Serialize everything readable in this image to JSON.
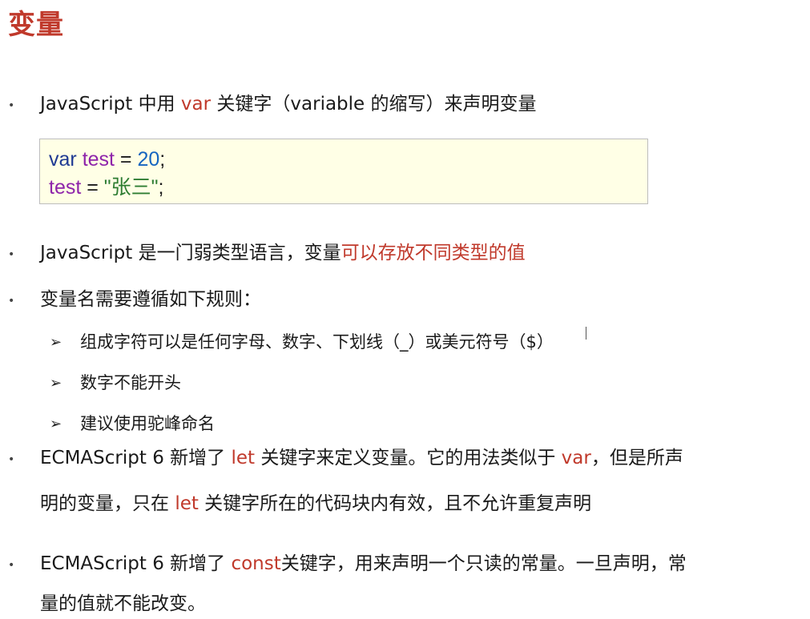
{
  "slide": {
    "title": "变量"
  },
  "bullets": [
    {
      "parts": [
        "JavaScript 中用 ",
        "var",
        " 关键字（variable 的缩写）来声明变量"
      ]
    },
    {
      "parts": [
        "JavaScript 是一门弱类型语言，变量",
        "可以存放不同类型的值"
      ]
    },
    {
      "text": "变量名需要遵循如下规则："
    },
    {
      "line1_parts": [
        "ECMAScript 6 新增了 ",
        "let",
        " 关键字来定义变量。它的用法类似于 ",
        "var",
        "，但是所声"
      ],
      "line2_parts": [
        "明的变量，只在 ",
        "let",
        " 关键字所在的代码块内有效，且不允许重复声明"
      ]
    },
    {
      "line1_parts": [
        "ECMAScript 6 新增了 ",
        "const",
        "关键字，用来声明一个只读的常量。一旦声明，常"
      ],
      "line2": "量的值就不能改变。"
    }
  ],
  "rules": [
    "组成字符可以是任何字母、数字、下划线（_）或美元符号（$）",
    "数字不能开头",
    "建议使用驼峰命名"
  ],
  "code": {
    "line1": {
      "kw": "var",
      "name": "test",
      "op": " = ",
      "value": "20",
      "end": ";"
    },
    "line2": {
      "name": "test",
      "op": " = ",
      "value": "\"张三\"",
      "end": ";"
    }
  },
  "icons": {
    "bullet": "•",
    "arrow": "➢"
  },
  "colors": {
    "accent": "#c0392b",
    "code_bg": "#ffffe6"
  }
}
